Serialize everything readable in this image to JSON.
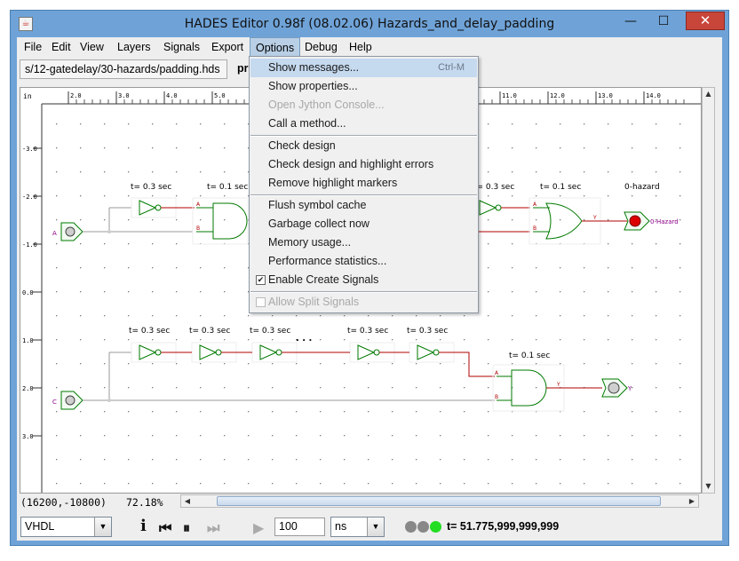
{
  "window": {
    "title": "HADES Editor 0.98f (08.02.06)   Hazards_and_delay_padding"
  },
  "menubar": [
    "File",
    "Edit",
    "View",
    "Layers",
    "Signals",
    "Export",
    "Options",
    "Debug",
    "Help"
  ],
  "path": "s/12-gatedelay/30-hazards/padding.hds",
  "path_extra": "pr",
  "ruler_h": [
    "2.0",
    "3.0",
    "4.0",
    "5.0",
    "6.0",
    "7.0",
    "8.0",
    "9.0",
    "10.0",
    "11.0",
    "12.0",
    "13.0",
    "14.0"
  ],
  "ruler_v": [
    "-3.0",
    "-2.0",
    "-1.0",
    "0.0",
    "1.0",
    "2.0",
    "3.0"
  ],
  "ruler_unit": "in",
  "schematic": {
    "delays_top": [
      "t= 0.3 sec",
      "t= 0.1 sec",
      "t= 0.3 sec",
      "t= 0.1 sec"
    ],
    "delays_bottom": [
      "t= 0.3 sec",
      "t= 0.3 sec",
      "t= 0.3 sec",
      "t= 0.3 sec",
      "t= 0.3 sec",
      "t= 0.1 sec"
    ],
    "probe_top": "0-hazard",
    "probe_top_sig": "0-Hazard",
    "probe_bottom_sig": "Y",
    "input_a": "A",
    "input_c": "C",
    "pin_a": "A",
    "pin_b": "B",
    "pin_y": "Y",
    "ellipsis": ". . ."
  },
  "options_menu": {
    "items": [
      {
        "label": "Show messages...",
        "shortcut": "Ctrl-M",
        "enabled": true
      },
      {
        "label": "Show properties...",
        "enabled": true
      },
      {
        "label": "Open Jython Console...",
        "enabled": false
      },
      {
        "label": "Call a method...",
        "enabled": true
      },
      {
        "label": "Check design",
        "enabled": true
      },
      {
        "label": "Check design and highlight errors",
        "enabled": true
      },
      {
        "label": "Remove highlight markers",
        "enabled": true
      },
      {
        "label": "Flush symbol cache",
        "enabled": true
      },
      {
        "label": "Garbage collect now",
        "enabled": true
      },
      {
        "label": "Memory usage...",
        "enabled": true
      },
      {
        "label": "Performance statistics...",
        "enabled": true
      },
      {
        "label": "Enable Create Signals",
        "enabled": true,
        "checked": true
      },
      {
        "label": "Allow Split Signals",
        "enabled": false,
        "checked": false
      }
    ]
  },
  "status": {
    "coords": "(16200,-10800)",
    "zoom": "72.18%"
  },
  "toolbar": {
    "language": "VHDL",
    "step_value": "100",
    "unit": "ns",
    "sim_time": "t= 51.775,999,999,999"
  },
  "colors": {
    "wire_red": "#b00000",
    "gate_green": "#007a00",
    "led_on": "#22dd22",
    "led_off": "#888888",
    "probe_red": "#dd0000"
  }
}
